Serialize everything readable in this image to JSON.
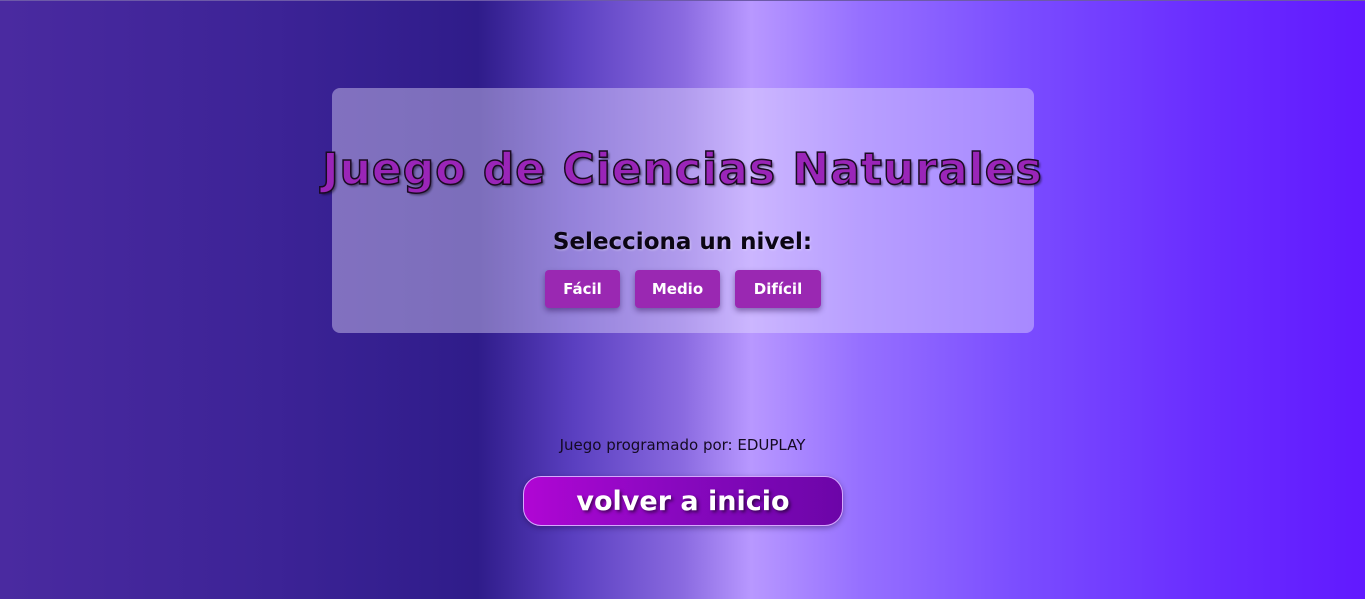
{
  "header": {
    "title": "Juego de Ciencias Naturales",
    "subtitle": "Selecciona un nivel:"
  },
  "levels": [
    {
      "label": "Fácil"
    },
    {
      "label": "Medio"
    },
    {
      "label": "Difícil"
    }
  ],
  "footer": {
    "credit": "Juego programado por: EDUPLAY",
    "back_label": "volver a inicio"
  },
  "colors": {
    "title_fill": "#9a25b8",
    "level_button": "#9a28b2",
    "back_button_start": "#b006d4",
    "back_button_end": "#6c05a8"
  }
}
